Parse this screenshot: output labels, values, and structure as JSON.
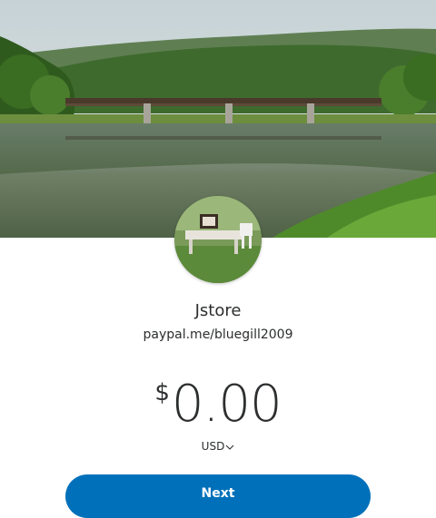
{
  "profile": {
    "name": "Jstore",
    "link": "paypal.me/bluegill2009"
  },
  "payment": {
    "currency_symbol": "$",
    "amount": "0.00",
    "currency_code": "USD"
  },
  "actions": {
    "next_label": "Next"
  },
  "colors": {
    "primary_button": "#0070ba",
    "text": "#2c2e2f",
    "background": "#ffffff"
  },
  "icons": {
    "currency_dropdown": "chevron-down-icon"
  }
}
